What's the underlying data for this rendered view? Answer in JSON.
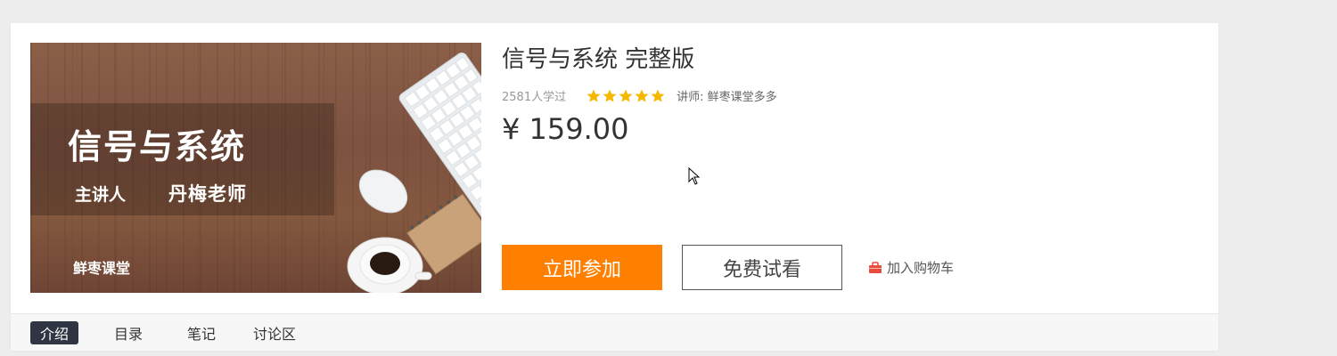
{
  "course": {
    "title": "信号与系统 完整版",
    "learners": "2581人学过",
    "rating": 5,
    "teacher_line": "讲师: 鲜枣课堂多多",
    "price": "¥ 159.00"
  },
  "cover": {
    "title": "信号与系统",
    "teacher_label": "主讲人",
    "teacher_name": "丹梅老师",
    "brand": "鲜枣课堂"
  },
  "actions": {
    "join_label": "立即参加",
    "trial_label": "免费试看",
    "cart_label": "加入购物车"
  },
  "tabs": [
    {
      "label": "介绍",
      "active": true
    },
    {
      "label": "目录",
      "active": false
    },
    {
      "label": "笔记",
      "active": false
    },
    {
      "label": "讨论区",
      "active": false
    }
  ],
  "colors": {
    "accent": "#ff7f00",
    "star": "#f5b800",
    "active_tab": "#2f3542",
    "cart_icon": "#e84c3d"
  },
  "icons": {
    "star": "star-icon",
    "cart": "cart-icon",
    "cursor": "mouse-pointer-icon"
  }
}
